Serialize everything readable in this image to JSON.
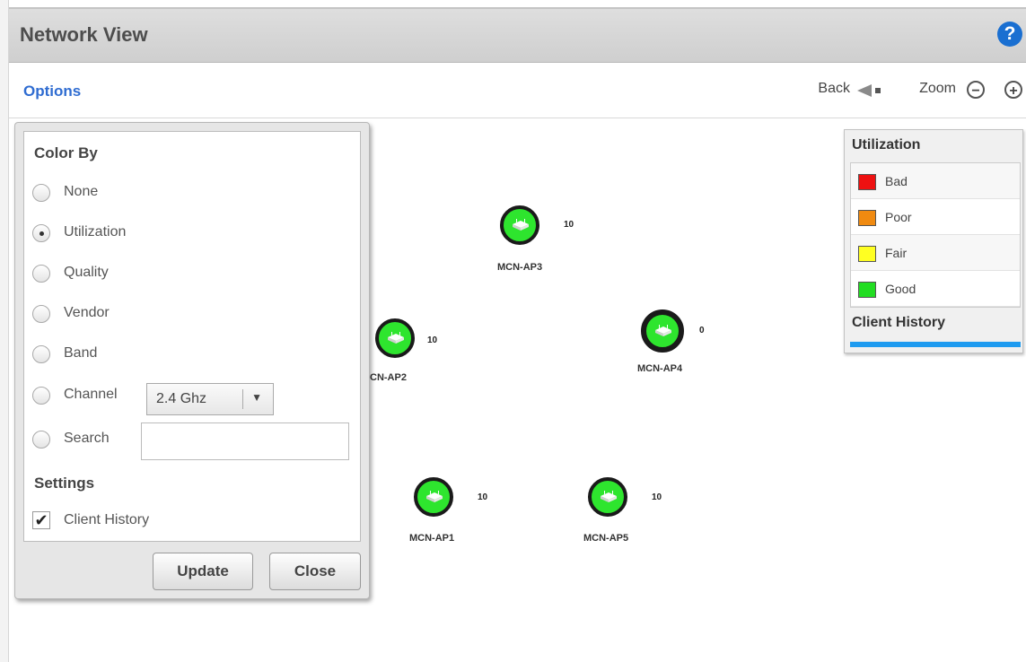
{
  "header": {
    "title": "Network View",
    "help_icon": "?"
  },
  "toolbar": {
    "options_label": "Options",
    "back_label": "Back",
    "zoom_label": "Zoom",
    "zoom_out": "−",
    "zoom_in": "+"
  },
  "options_panel": {
    "color_by_heading": "Color By",
    "radios": [
      {
        "label": "None",
        "checked": false
      },
      {
        "label": "Utilization",
        "checked": true
      },
      {
        "label": "Quality",
        "checked": false
      },
      {
        "label": "Vendor",
        "checked": false
      },
      {
        "label": "Band",
        "checked": false
      },
      {
        "label": "Channel",
        "checked": false
      },
      {
        "label": "Search",
        "checked": false
      }
    ],
    "channel_select": {
      "value": "2.4 Ghz",
      "arrow": "▼"
    },
    "search_value": "",
    "settings_heading": "Settings",
    "client_history": {
      "label": "Client History",
      "checked": true,
      "mark": "✔"
    },
    "update_label": "Update",
    "close_label": "Close"
  },
  "access_points": [
    {
      "name": "MCN-AP3",
      "count": "10"
    },
    {
      "name": "CN-AP2",
      "count": "10"
    },
    {
      "name": "MCN-AP4",
      "count": "0"
    },
    {
      "name": "MCN-AP1",
      "count": "10"
    },
    {
      "name": "MCN-AP5",
      "count": "10"
    }
  ],
  "legend": {
    "title": "Utilization",
    "items": [
      {
        "label": "Bad",
        "color": "#ee1111"
      },
      {
        "label": "Poor",
        "color": "#f08a10"
      },
      {
        "label": "Fair",
        "color": "#ffff22"
      },
      {
        "label": "Good",
        "color": "#22dd22"
      }
    ],
    "client_history_title": "Client History",
    "client_history_color": "#1e9bf0"
  }
}
